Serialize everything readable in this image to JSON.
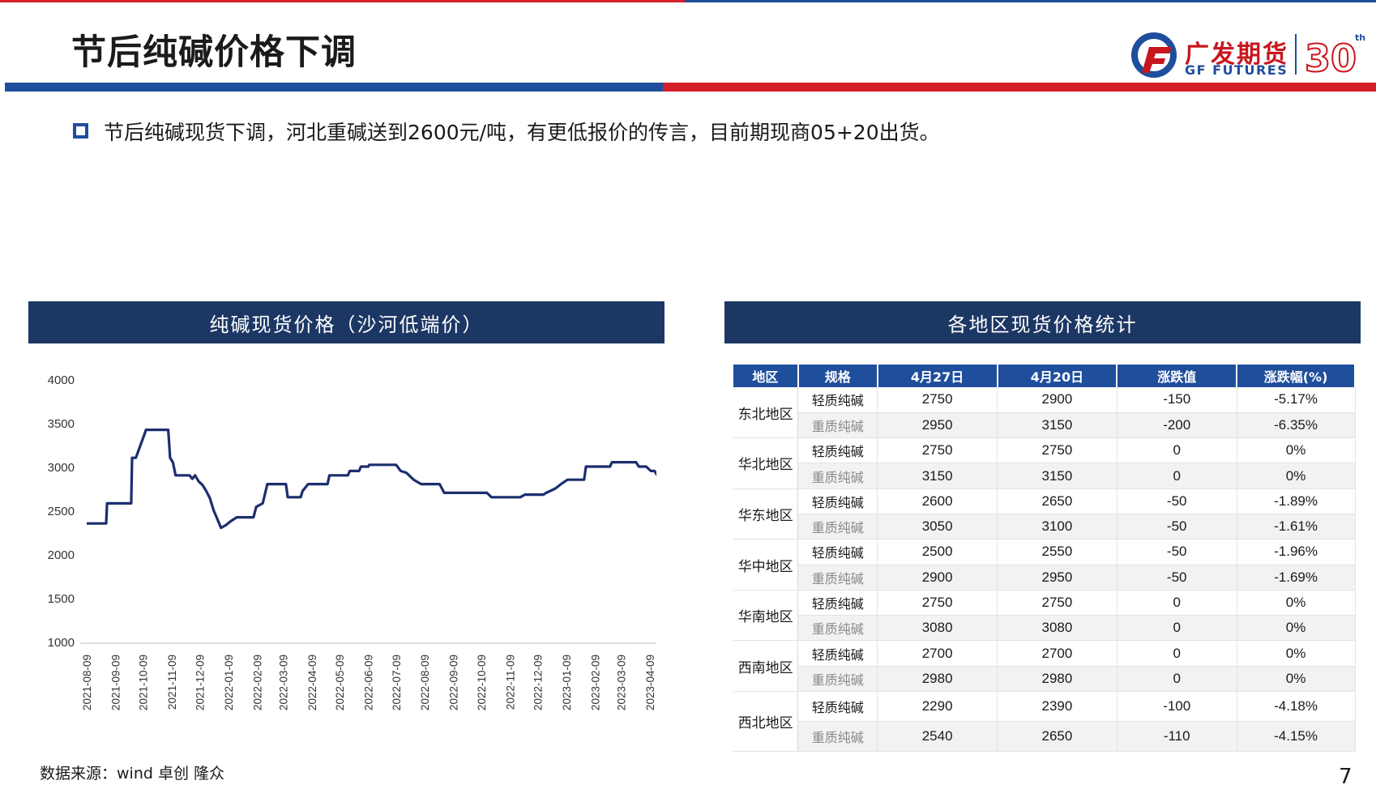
{
  "page": {
    "title": "节后纯碱价格下调",
    "bullet": "节后纯碱现货下调，河北重碱送到2600元/吨，有更低报价的传言，目前期现商05+20出货。",
    "source": "数据来源：wind 卓创 隆众",
    "page_number": "7"
  },
  "logo": {
    "cn": "广发期货",
    "en": "GF FUTURES",
    "anniversary": "30",
    "anniversary_suffix": "th",
    "brand_red": "#c8161d",
    "brand_blue": "#1f4e9c"
  },
  "colors": {
    "header_blue": "#1f4e9c",
    "header_red": "#d5202a",
    "panel_navy": "#1c3764",
    "line": "#1c2e6e"
  },
  "left_panel": {
    "title": "纯碱现货价格（沙河低端价）"
  },
  "right_panel": {
    "title": "各地区现货价格统计"
  },
  "chart_data": {
    "type": "line",
    "title": "纯碱现货价格（沙河低端价）",
    "xlabel": "",
    "ylabel": "",
    "ylim": [
      1000,
      4000
    ],
    "yticks": [
      4000,
      3500,
      3000,
      2500,
      2000,
      1500,
      1000
    ],
    "xticks": [
      "2021-08-09",
      "2021-09-09",
      "2021-10-09",
      "2021-11-09",
      "2021-12-09",
      "2022-01-09",
      "2022-02-09",
      "2022-03-09",
      "2022-04-09",
      "2022-05-09",
      "2022-06-09",
      "2022-07-09",
      "2022-08-09",
      "2022-09-09",
      "2022-10-09",
      "2022-11-09",
      "2022-12-09",
      "2023-01-09",
      "2023-02-09",
      "2023-03-09",
      "2023-04-09"
    ],
    "grid": false,
    "legend": "none",
    "series": [
      {
        "points": [
          [
            "2021-08-09",
            2350
          ],
          [
            "2021-08-30",
            2350
          ],
          [
            "2021-08-31",
            2580
          ],
          [
            "2021-09-26",
            2580
          ],
          [
            "2021-09-27",
            3100
          ],
          [
            "2021-10-01",
            3100
          ],
          [
            "2021-10-09",
            3330
          ],
          [
            "2021-10-12",
            3420
          ],
          [
            "2021-11-05",
            3420
          ],
          [
            "2021-11-07",
            3100
          ],
          [
            "2021-11-10",
            3050
          ],
          [
            "2021-11-13",
            2900
          ],
          [
            "2021-11-28",
            2900
          ],
          [
            "2021-12-01",
            2860
          ],
          [
            "2021-12-04",
            2900
          ],
          [
            "2021-12-08",
            2830
          ],
          [
            "2021-12-12",
            2790
          ],
          [
            "2021-12-16",
            2720
          ],
          [
            "2021-12-20",
            2640
          ],
          [
            "2021-12-24",
            2500
          ],
          [
            "2021-12-28",
            2400
          ],
          [
            "2022-01-01",
            2300
          ],
          [
            "2022-01-06",
            2330
          ],
          [
            "2022-01-12",
            2380
          ],
          [
            "2022-01-18",
            2420
          ],
          [
            "2022-02-05",
            2420
          ],
          [
            "2022-02-08",
            2540
          ],
          [
            "2022-02-15",
            2580
          ],
          [
            "2022-02-20",
            2800
          ],
          [
            "2022-03-12",
            2800
          ],
          [
            "2022-03-14",
            2650
          ],
          [
            "2022-03-28",
            2650
          ],
          [
            "2022-03-30",
            2720
          ],
          [
            "2022-04-05",
            2800
          ],
          [
            "2022-04-26",
            2800
          ],
          [
            "2022-04-28",
            2900
          ],
          [
            "2022-05-18",
            2900
          ],
          [
            "2022-05-20",
            2950
          ],
          [
            "2022-05-30",
            2950
          ],
          [
            "2022-06-01",
            3000
          ],
          [
            "2022-06-09",
            3000
          ],
          [
            "2022-06-10",
            3020
          ],
          [
            "2022-07-09",
            3020
          ],
          [
            "2022-07-14",
            2950
          ],
          [
            "2022-07-20",
            2930
          ],
          [
            "2022-07-28",
            2850
          ],
          [
            "2022-08-05",
            2800
          ],
          [
            "2022-08-25",
            2800
          ],
          [
            "2022-08-30",
            2700
          ],
          [
            "2022-10-15",
            2700
          ],
          [
            "2022-10-20",
            2650
          ],
          [
            "2022-11-20",
            2650
          ],
          [
            "2022-11-25",
            2680
          ],
          [
            "2022-12-15",
            2680
          ],
          [
            "2022-12-18",
            2700
          ],
          [
            "2022-12-28",
            2750
          ],
          [
            "2023-01-03",
            2800
          ],
          [
            "2023-01-10",
            2850
          ],
          [
            "2023-01-28",
            2850
          ],
          [
            "2023-01-30",
            3000
          ],
          [
            "2023-02-25",
            3000
          ],
          [
            "2023-02-27",
            3050
          ],
          [
            "2023-03-25",
            3050
          ],
          [
            "2023-03-28",
            3000
          ],
          [
            "2023-04-05",
            3000
          ],
          [
            "2023-04-10",
            2950
          ],
          [
            "2023-04-14",
            2950
          ],
          [
            "2023-04-17",
            2900
          ],
          [
            "2023-04-20",
            2900
          ],
          [
            "2023-04-22",
            2880
          ]
        ]
      }
    ]
  },
  "table": {
    "headers": [
      "地区",
      "规格",
      "4月27日",
      "4月20日",
      "涨跌值",
      "涨跌幅(%)"
    ],
    "rows": [
      {
        "region": "东北地区",
        "spec": "轻质纯碱",
        "d1": "2750",
        "d0": "2900",
        "chg": "-150",
        "pct": "-5.17%"
      },
      {
        "region": "",
        "spec": "重质纯碱",
        "d1": "2950",
        "d0": "3150",
        "chg": "-200",
        "pct": "-6.35%"
      },
      {
        "region": "华北地区",
        "spec": "轻质纯碱",
        "d1": "2750",
        "d0": "2750",
        "chg": "0",
        "pct": "0%"
      },
      {
        "region": "",
        "spec": "重质纯碱",
        "d1": "3150",
        "d0": "3150",
        "chg": "0",
        "pct": "0%"
      },
      {
        "region": "华东地区",
        "spec": "轻质纯碱",
        "d1": "2600",
        "d0": "2650",
        "chg": "-50",
        "pct": "-1.89%"
      },
      {
        "region": "",
        "spec": "重质纯碱",
        "d1": "3050",
        "d0": "3100",
        "chg": "-50",
        "pct": "-1.61%"
      },
      {
        "region": "华中地区",
        "spec": "轻质纯碱",
        "d1": "2500",
        "d0": "2550",
        "chg": "-50",
        "pct": "-1.96%"
      },
      {
        "region": "",
        "spec": "重质纯碱",
        "d1": "2900",
        "d0": "2950",
        "chg": "-50",
        "pct": "-1.69%"
      },
      {
        "region": "华南地区",
        "spec": "轻质纯碱",
        "d1": "2750",
        "d0": "2750",
        "chg": "0",
        "pct": "0%"
      },
      {
        "region": "",
        "spec": "重质纯碱",
        "d1": "3080",
        "d0": "3080",
        "chg": "0",
        "pct": "0%"
      },
      {
        "region": "西南地区",
        "spec": "轻质纯碱",
        "d1": "2700",
        "d0": "2700",
        "chg": "0",
        "pct": "0%"
      },
      {
        "region": "",
        "spec": "重质纯碱",
        "d1": "2980",
        "d0": "2980",
        "chg": "0",
        "pct": "0%"
      },
      {
        "region": "西北地区",
        "spec": "轻质纯碱",
        "d1": "2290",
        "d0": "2390",
        "chg": "-100",
        "pct": "-4.18%"
      },
      {
        "region": "",
        "spec": "重质纯碱",
        "d1": "2540",
        "d0": "2650",
        "chg": "-110",
        "pct": "-4.15%"
      }
    ]
  }
}
